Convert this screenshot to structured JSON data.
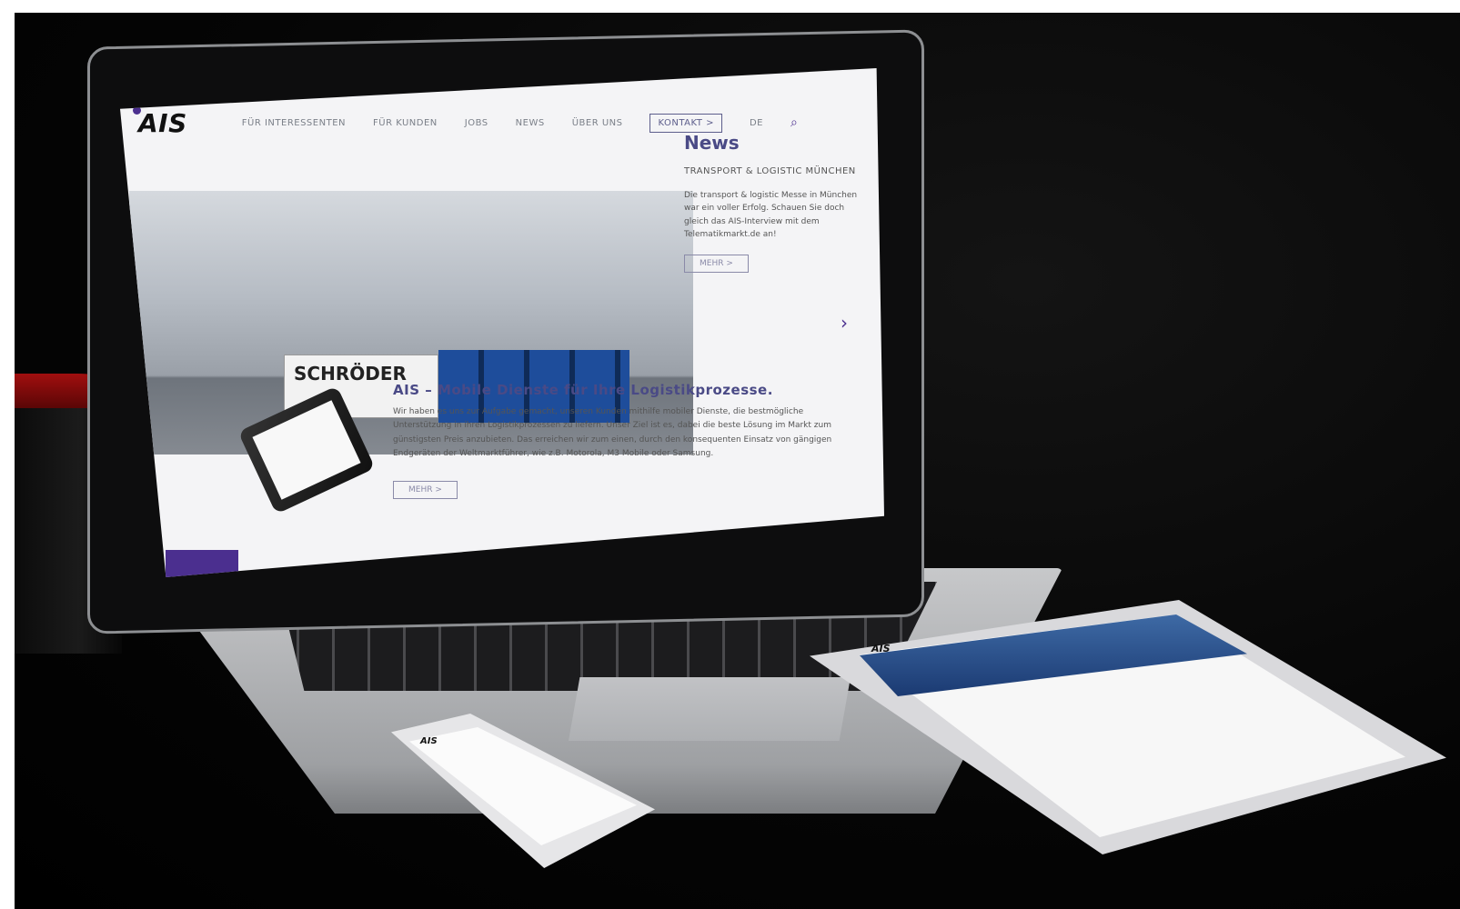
{
  "laptop": {
    "logo": "AIS",
    "nav": [
      "FÜR INTERESSENTEN",
      "FÜR KUNDEN",
      "JOBS",
      "NEWS",
      "ÜBER UNS"
    ],
    "kontakt": "KONTAKT >",
    "lang": "DE",
    "hero_truck_text": "SCHRÖDER",
    "news": {
      "title": "News",
      "subtitle": "TRANSPORT & LOGISTIC MÜNCHEN",
      "text": "Die transport & logistic Messe in München war ein voller Erfolg. Schauen Sie doch gleich das AIS-Interview mit dem Telematikmarkt.de an!",
      "button": "MEHR >"
    },
    "content": {
      "heading": "AIS – Mobile Dienste für Ihre Logistikprozesse.",
      "text": "Wir haben es uns zur Aufgabe gemacht, unseren Kunden mithilfe mobiler Dienste, die bestmögliche Unterstützung in ihren Logistikprozessen zu liefern. Unser Ziel ist es, dabei die beste Lösung im Markt zum günstigsten Preis anzubieten. Das erreichen wir zum einen, durch den konsequenten Einsatz von gängigen Endgeräten der Weltmarktführer, wie z.B. Motorola, M3 Mobile oder Samsung.",
      "button": "MEHR >"
    }
  },
  "tablet": {
    "logo": "AIS"
  },
  "phone": {
    "logo": "AIS"
  }
}
